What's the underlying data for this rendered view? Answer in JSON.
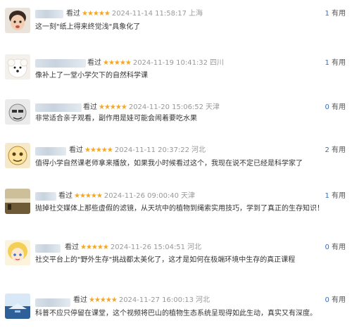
{
  "reviews": [
    {
      "watched": "看过",
      "stars": "★★★★★",
      "time": "2024-11-14 11:58:17",
      "location": "上海",
      "comment": "这一刻\"纸上得来终觉浅\"具象化了",
      "useful_count": "1",
      "useful_label": "有用",
      "avatar": "baby-avatar-icon"
    },
    {
      "watched": "看过",
      "stars": "★★★★★",
      "time": "2024-11-19 10:41:32",
      "location": "四川",
      "comment": "像补上了一堂小学欠下的自然科学课",
      "useful_count": "1",
      "useful_label": "有用",
      "avatar": "dog-avatar-icon"
    },
    {
      "watched": "看过",
      "stars": "★★★★★",
      "time": "2024-11-20 15:06:52",
      "location": "天津",
      "comment": "非常适合亲子观看，副作用是娃可能会闹着要吃水果",
      "useful_count": "0",
      "useful_label": "有用",
      "avatar": "cartoon-face-avatar-icon"
    },
    {
      "watched": "看过",
      "stars": "★★★★★",
      "time": "2024-11-11 20:37:22",
      "location": "河北",
      "comment": "值得小学自然课老师拿来播放，如果我小时候看过这个，我现在说不定已经是科学家了",
      "useful_count": "2",
      "useful_label": "有用",
      "avatar": "emoji-avatar-icon"
    },
    {
      "watched": "看过",
      "stars": "★★★★★",
      "time": "2024-11-26 09:00:40",
      "location": "天津",
      "comment": "抛掉社交媒体上那些虚假的滤镜，从天坑中的植物到绳索实用技巧，学到了真正的生存知识！",
      "useful_count": "1",
      "useful_label": "有用",
      "avatar": "landscape-avatar-icon"
    },
    {
      "watched": "看过",
      "stars": "★★★★★",
      "time": "2024-11-26 15:04:51",
      "location": "河北",
      "comment": "社交平台上的\"野外生存\"挑战都太美化了，这才是如何在极端环境中生存的真正课程",
      "useful_count": "0",
      "useful_label": "有用",
      "avatar": "anime-girl-avatar-icon"
    },
    {
      "watched": "看过",
      "stars": "★★★★★",
      "time": "2024-11-27 16:00:13",
      "location": "河北",
      "comment": "科普不应只停留在课堂，这个视频将巴山的植物生态系统呈现得如此生动，真实又有深度。",
      "useful_count": "0",
      "useful_label": "有用",
      "avatar": "water-landscape-avatar-icon"
    }
  ]
}
